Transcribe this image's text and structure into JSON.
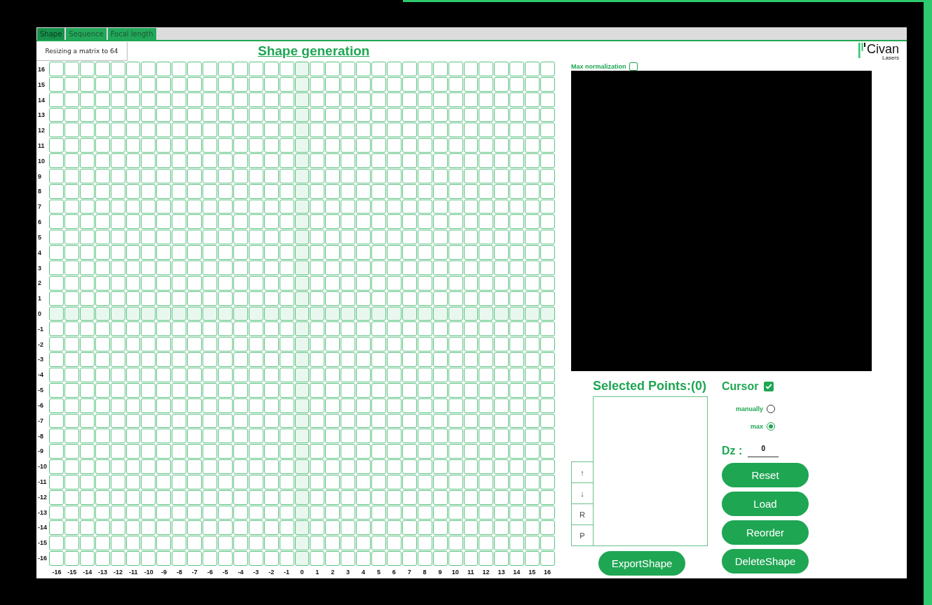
{
  "tabs": [
    {
      "label": "Shape",
      "selected": true
    },
    {
      "label": "Sequence",
      "selected": false
    },
    {
      "label": "Focal length",
      "selected": false
    }
  ],
  "status_box": {
    "text": "Resizing a matrix to 64"
  },
  "title": "Shape generation",
  "logo": {
    "name": "Civan",
    "tagline": "Lasers"
  },
  "grid": {
    "row_labels": [
      "16",
      "15",
      "14",
      "13",
      "12",
      "11",
      "10",
      "9",
      "8",
      "7",
      "6",
      "5",
      "4",
      "3",
      "2",
      "1",
      "0",
      "-1",
      "-2",
      "-3",
      "-4",
      "-5",
      "-6",
      "-7",
      "-8",
      "-9",
      "-10",
      "-11",
      "-12",
      "-13",
      "-14",
      "-15",
      "-16"
    ],
    "column_labels": [
      "-16",
      "-15",
      "-14",
      "-13",
      "-12",
      "-11",
      "-10",
      "-9",
      "-8",
      "-7",
      "-6",
      "-5",
      "-4",
      "-3",
      "-2",
      "-1",
      "0",
      "1",
      "2",
      "3",
      "4",
      "5",
      "6",
      "7",
      "8",
      "9",
      "10",
      "11",
      "12",
      "13",
      "14",
      "15",
      "16"
    ]
  },
  "max_normalization": {
    "label": "Max normalization",
    "checked": false
  },
  "selected_points": {
    "title": "Selected Points:(0)",
    "side_buttons": [
      "↑",
      "↓",
      "R",
      "P"
    ],
    "export_button": "ExportShape"
  },
  "cursor": {
    "label": "Cursor",
    "checked": true,
    "modes": [
      {
        "label": "manually",
        "selected": false
      },
      {
        "label": "max",
        "selected": true
      }
    ]
  },
  "dz": {
    "label": "Dz :",
    "value": "0"
  },
  "buttons": [
    "Reset",
    "Load",
    "Reorder",
    "DeleteShape"
  ]
}
